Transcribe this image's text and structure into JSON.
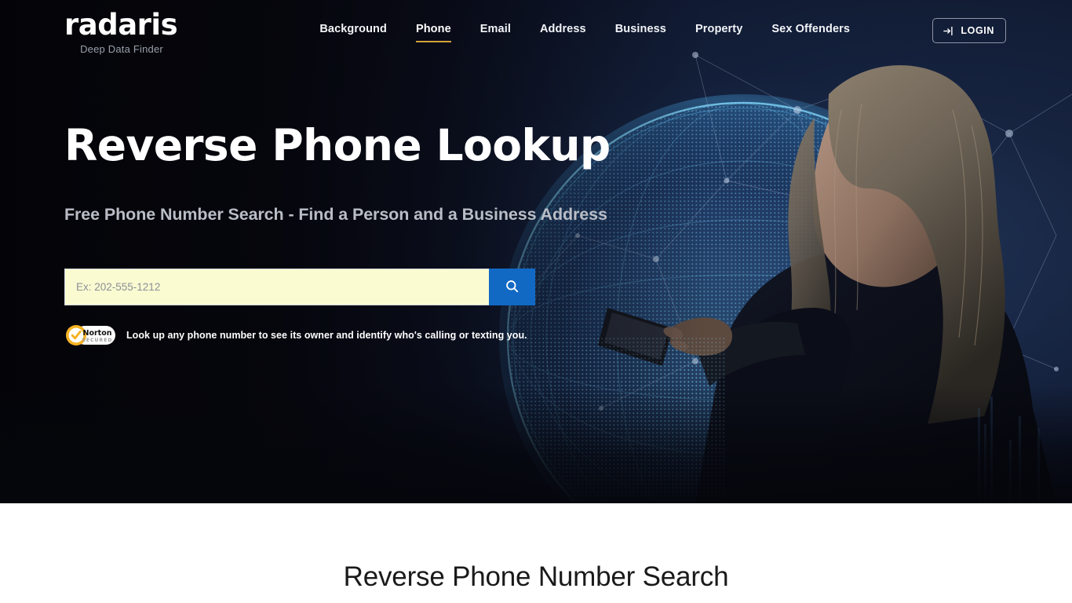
{
  "header": {
    "logo": {
      "word": "radaris",
      "tagline": "Deep Data Finder"
    },
    "nav": [
      {
        "label": "Background",
        "active": false
      },
      {
        "label": "Phone",
        "active": true
      },
      {
        "label": "Email",
        "active": false
      },
      {
        "label": "Address",
        "active": false
      },
      {
        "label": "Business",
        "active": false
      },
      {
        "label": "Property",
        "active": false
      },
      {
        "label": "Sex Offenders",
        "active": false
      }
    ],
    "login_label": "LOGIN",
    "login_icon": "sign-in-icon"
  },
  "hero": {
    "title": "Reverse Phone Lookup",
    "subtitle": "Free Phone Number Search - Find a Person and a Business Address",
    "search": {
      "placeholder": "Ex: 202-555-1212",
      "value": "",
      "button_icon": "search-icon"
    },
    "trust": {
      "badge_name": "Norton",
      "badge_sub": "SECURED",
      "text": "Look up any phone number to see its owner and identify who's calling or texting you."
    },
    "image_alt": "woman-using-phone-with-network-globe"
  },
  "below_fold": {
    "section_title": "Reverse Phone Number Search"
  },
  "colors": {
    "accent_underline": "#d4a03c",
    "search_button": "#1169c4",
    "input_background": "#fbfbd2",
    "hero_background": "#0a0a12",
    "norton_yellow": "#f5b323"
  }
}
